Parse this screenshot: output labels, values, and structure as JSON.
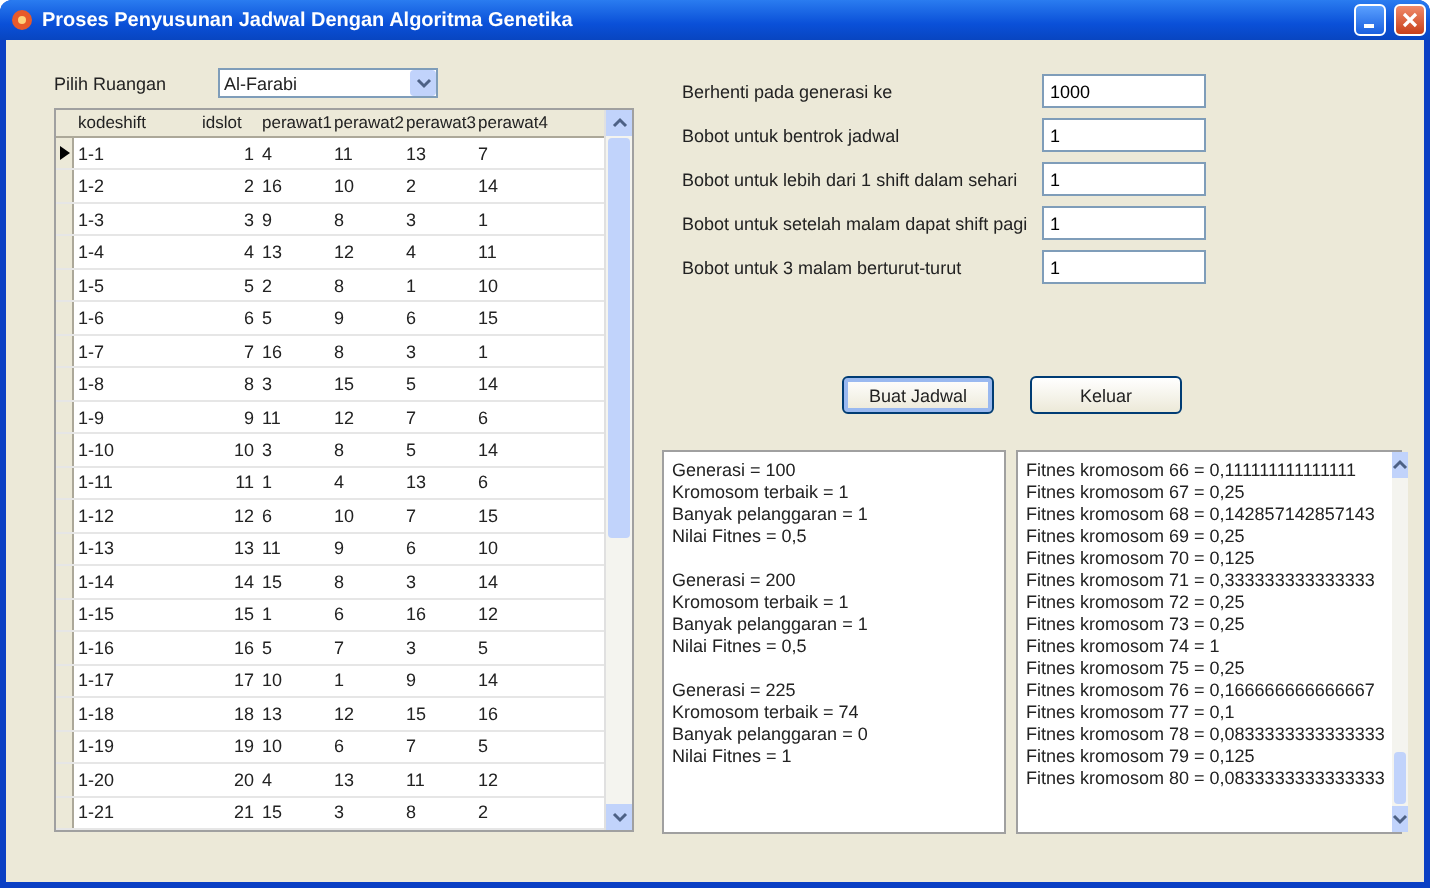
{
  "window": {
    "title": "Proses Penyusunan Jadwal Dengan Algoritma Genetika"
  },
  "room_picker": {
    "label": "Pilih Ruangan",
    "value": "Al-Farabi"
  },
  "grid": {
    "columns": [
      "kodeshift",
      "idslot",
      "perawat1",
      "perawat2",
      "perawat3",
      "perawat4"
    ],
    "rows": [
      {
        "cells": [
          "1-1",
          "1",
          "4",
          "11",
          "13",
          "7"
        ],
        "selected": true
      },
      {
        "cells": [
          "1-2",
          "2",
          "16",
          "10",
          "2",
          "14"
        ],
        "selected": false
      },
      {
        "cells": [
          "1-3",
          "3",
          "9",
          "8",
          "3",
          "1"
        ],
        "selected": false
      },
      {
        "cells": [
          "1-4",
          "4",
          "13",
          "12",
          "4",
          "11"
        ],
        "selected": false
      },
      {
        "cells": [
          "1-5",
          "5",
          "2",
          "8",
          "1",
          "10"
        ],
        "selected": false
      },
      {
        "cells": [
          "1-6",
          "6",
          "5",
          "9",
          "6",
          "15"
        ],
        "selected": false
      },
      {
        "cells": [
          "1-7",
          "7",
          "16",
          "8",
          "3",
          "1"
        ],
        "selected": false
      },
      {
        "cells": [
          "1-8",
          "8",
          "3",
          "15",
          "5",
          "14"
        ],
        "selected": false
      },
      {
        "cells": [
          "1-9",
          "9",
          "11",
          "12",
          "7",
          "6"
        ],
        "selected": false
      },
      {
        "cells": [
          "1-10",
          "10",
          "3",
          "8",
          "5",
          "14"
        ],
        "selected": false
      },
      {
        "cells": [
          "1-11",
          "11",
          "1",
          "4",
          "13",
          "6"
        ],
        "selected": false
      },
      {
        "cells": [
          "1-12",
          "12",
          "6",
          "10",
          "7",
          "15"
        ],
        "selected": false
      },
      {
        "cells": [
          "1-13",
          "13",
          "11",
          "9",
          "6",
          "10"
        ],
        "selected": false
      },
      {
        "cells": [
          "1-14",
          "14",
          "15",
          "8",
          "3",
          "14"
        ],
        "selected": false
      },
      {
        "cells": [
          "1-15",
          "15",
          "1",
          "6",
          "16",
          "12"
        ],
        "selected": false
      },
      {
        "cells": [
          "1-16",
          "16",
          "5",
          "7",
          "3",
          "5"
        ],
        "selected": false
      },
      {
        "cells": [
          "1-17",
          "17",
          "10",
          "1",
          "9",
          "14"
        ],
        "selected": false
      },
      {
        "cells": [
          "1-18",
          "18",
          "13",
          "12",
          "15",
          "16"
        ],
        "selected": false
      },
      {
        "cells": [
          "1-19",
          "19",
          "10",
          "6",
          "7",
          "5"
        ],
        "selected": false
      },
      {
        "cells": [
          "1-20",
          "20",
          "4",
          "13",
          "11",
          "12"
        ],
        "selected": false
      },
      {
        "cells": [
          "1-21",
          "21",
          "15",
          "3",
          "8",
          "2"
        ],
        "selected": false
      }
    ]
  },
  "settings": [
    {
      "label": "Berhenti pada generasi ke",
      "value": "1000"
    },
    {
      "label": "Bobot untuk bentrok jadwal",
      "value": "1"
    },
    {
      "label": "Bobot untuk lebih dari 1 shift dalam sehari",
      "value": "1"
    },
    {
      "label": "Bobot untuk setelah malam dapat shift pagi",
      "value": "1"
    },
    {
      "label": "Bobot untuk 3 malam berturut-turut",
      "value": "1"
    }
  ],
  "buttons": [
    {
      "label": "Buat Jadwal",
      "focused": true
    },
    {
      "label": "Keluar",
      "focused": false
    }
  ],
  "log_left": [
    [
      "Generasi = 100",
      "Kromosom terbaik = 1",
      "Banyak pelanggaran = 1",
      "Nilai Fitnes = 0,5"
    ],
    [
      "Generasi = 200",
      "Kromosom terbaik = 1",
      "Banyak pelanggaran = 1",
      "Nilai Fitnes = 0,5"
    ],
    [
      "Generasi = 225",
      "Kromosom terbaik = 74",
      "Banyak pelanggaran = 0",
      "Nilai Fitnes = 1"
    ]
  ],
  "log_right": [
    "Fitnes kromosom 66 = 0,111111111111111",
    "Fitnes kromosom 67 = 0,25",
    "Fitnes kromosom 68 = 0,142857142857143",
    "Fitnes kromosom 69 = 0,25",
    "Fitnes kromosom 70 = 0,125",
    "Fitnes kromosom 71 = 0,333333333333333",
    "Fitnes kromosom 72 = 0,25",
    "Fitnes kromosom 73 = 0,25",
    "Fitnes kromosom 74 = 1",
    "Fitnes kromosom 75 = 0,25",
    "Fitnes kromosom 76 = 0,166666666666667",
    "Fitnes kromosom 77 = 0,1",
    "Fitnes kromosom 78 = 0,0833333333333333",
    "Fitnes kromosom 79 = 0,125",
    "Fitnes kromosom 80 = 0,0833333333333333"
  ]
}
